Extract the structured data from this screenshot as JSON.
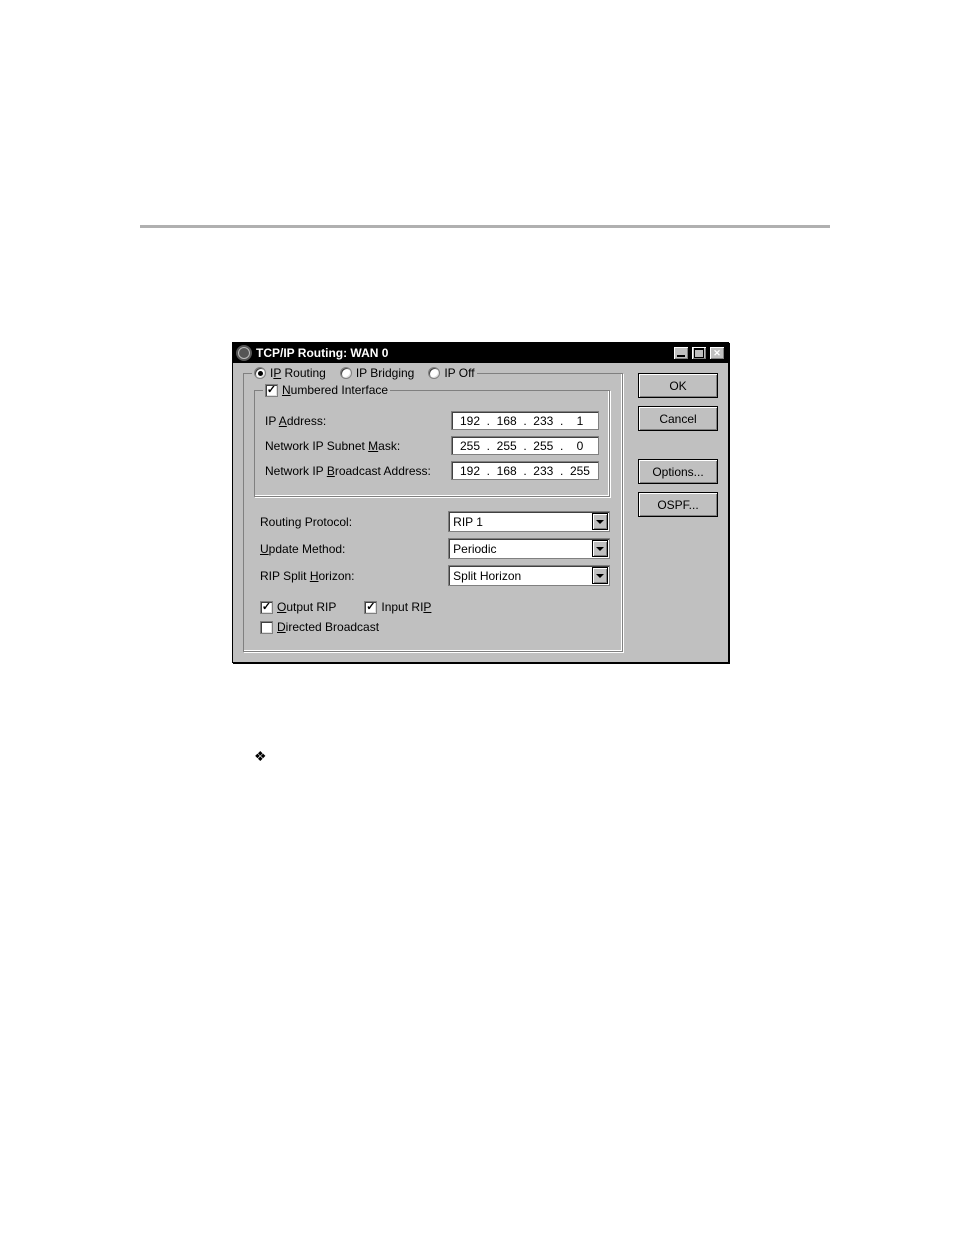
{
  "title": "TCP/IP Routing: WAN 0",
  "radios": {
    "routing": "IP Routing",
    "bridging": "IP Bridging",
    "off": "IP Off",
    "selected": "routing"
  },
  "numbered_interface": {
    "label": "Numbered Interface",
    "checked": true
  },
  "fields": {
    "ip_address": {
      "label": "IP Address:",
      "value": [
        "192",
        "168",
        "233",
        "1"
      ]
    },
    "subnet": {
      "label": "Network IP Subnet Mask:",
      "value": [
        "255",
        "255",
        "255",
        "0"
      ]
    },
    "broadcast": {
      "label": "Network IP Broadcast Address:",
      "value": [
        "192",
        "168",
        "233",
        "255"
      ]
    }
  },
  "selects": {
    "routing_protocol": {
      "label": "Routing Protocol:",
      "value": "RIP 1"
    },
    "update_method": {
      "label": "Update Method:",
      "value": "Periodic"
    },
    "split_horizon": {
      "label": "RIP Split Horizon:",
      "value": "Split Horizon"
    }
  },
  "checks": {
    "output_rip": {
      "label": "Output RIP",
      "checked": true
    },
    "input_rip": {
      "label": "Input RIP",
      "checked": true
    },
    "directed_broadcast": {
      "label": "Directed Broadcast",
      "checked": false
    }
  },
  "buttons": {
    "ok": "OK",
    "cancel": "Cancel",
    "options": "Options...",
    "ospf": "OSPF..."
  }
}
